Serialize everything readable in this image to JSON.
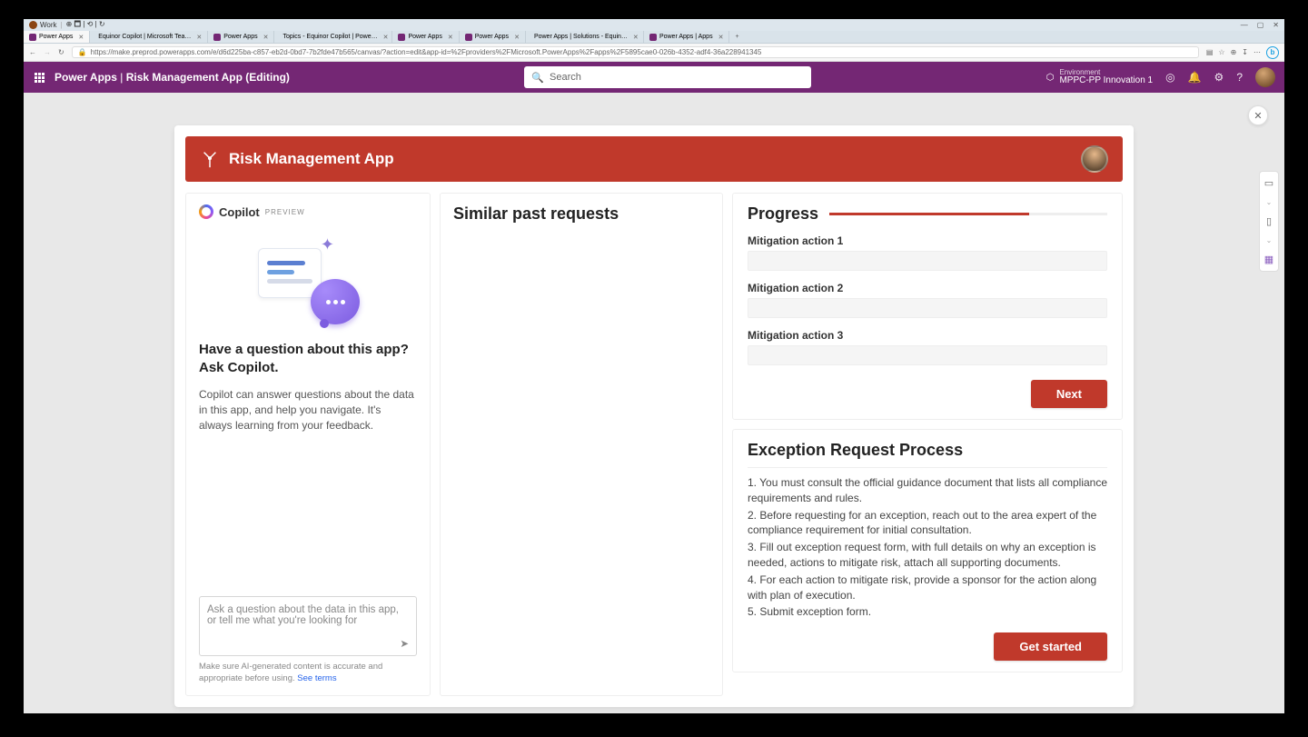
{
  "os": {
    "task_label": "Work"
  },
  "browser": {
    "tabs": [
      {
        "title": "Power Apps",
        "active": true,
        "favicon": "#742774"
      },
      {
        "title": "Equinor Copilot | Microsoft Tea…",
        "favicon": "#4b53bc"
      },
      {
        "title": "Power Apps",
        "favicon": "#742774"
      },
      {
        "title": "Topics - Equinor Copilot | Powe…",
        "favicon": "#0f6cbd"
      },
      {
        "title": "Power Apps",
        "favicon": "#742774"
      },
      {
        "title": "Power Apps",
        "favicon": "#742774"
      },
      {
        "title": "Power Apps | Solutions - Equin…",
        "favicon": "#742774"
      },
      {
        "title": "Power Apps | Apps",
        "favicon": "#742774"
      }
    ],
    "url": "https://make.preprod.powerapps.com/e/d6d225ba-c857-eb2d-0bd7-7b2fde47b565/canvas/?action=edit&app-id=%2Fproviders%2FMicrosoft.PowerApps%2Fapps%2F5895cae0-026b-4352-adf4-36a228941345"
  },
  "header": {
    "product": "Power Apps",
    "separator": " | ",
    "page": "Risk Management App (Editing)",
    "search_placeholder": "Search",
    "env_label": "Environment",
    "env_name": "MPPC-PP Innovation 1"
  },
  "app": {
    "title": "Risk Management App",
    "copilot": {
      "name": "Copilot",
      "badge": "PREVIEW",
      "heading": "Have a question about this app? Ask Copilot.",
      "description": "Copilot can answer questions about the data in this app, and help you navigate. It's always learning from your feedback.",
      "placeholder": "Ask a question about the data in this app, or tell me what you're looking for",
      "note_prefix": "Make sure AI-generated content is accurate and appropriate before using. ",
      "note_link": "See terms"
    },
    "similar": {
      "title": "Similar past requests"
    },
    "progress": {
      "title": "Progress",
      "items": [
        "Mitigation action 1",
        "Mitigation action 2",
        "Mitigation action 3"
      ],
      "next": "Next"
    },
    "process": {
      "title": "Exception Request Process",
      "steps": [
        "1. You must consult the official guidance document that lists all compliance requirements and rules.",
        "2. Before requesting for an exception, reach out to the area expert of the compliance requirement for initial consultation.",
        "3. Fill out exception request form, with full details on why an exception is needed, actions to mitigate risk, attach all supporting documents.",
        "4. For each action to mitigate risk, provide a sponsor for the action along with plan of execution.",
        "5. Submit exception form."
      ],
      "cta": "Get started"
    }
  }
}
